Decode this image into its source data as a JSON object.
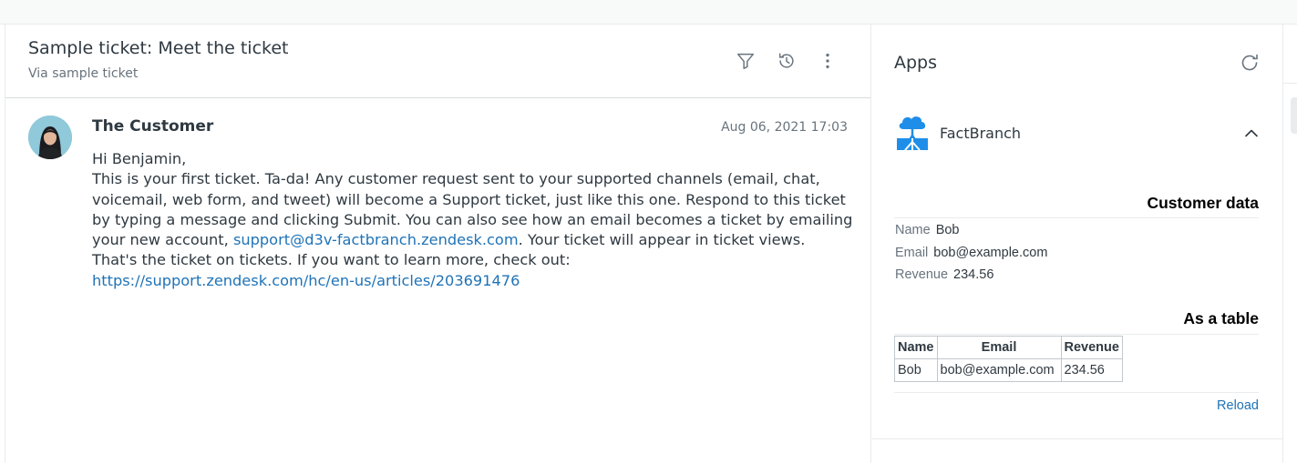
{
  "ticket": {
    "title": "Sample ticket: Meet the ticket",
    "via": "Via sample ticket",
    "icons": [
      "filter-icon",
      "history-icon",
      "more-options-icon"
    ]
  },
  "message": {
    "author": "The Customer",
    "timestamp": "Aug 06, 2021 17:03",
    "greeting": "Hi Benjamin,",
    "para1": "This is your first ticket. Ta-da! Any customer request sent to your supported channels (email, chat, voicemail, web form, and tweet) will become a Support ticket, just like this one. Respond to this ticket by typing a message and clicking Submit. You can also see how an email becomes a ticket by emailing your new account, ",
    "email_link": "support@d3v-factbranch.zendesk.com",
    "para1_end": ". Your ticket will appear in ticket views.",
    "para2": "That's the ticket on tickets. If you want to learn more, check out:",
    "url_link": "https://support.zendesk.com/hc/en-us/articles/203691476"
  },
  "apps": {
    "title": "Apps",
    "app_name": "FactBranch",
    "customer_data_title": "Customer data",
    "fields": [
      {
        "key": "Name",
        "value": "Bob"
      },
      {
        "key": "Email",
        "value": "bob@example.com"
      },
      {
        "key": "Revenue",
        "value": "234.56"
      }
    ],
    "table_title": "As a table",
    "table": {
      "headers": [
        "Name",
        "Email",
        "Revenue"
      ],
      "rows": [
        [
          "Bob",
          "bob@example.com",
          "234.56"
        ]
      ]
    },
    "reload_label": "Reload"
  },
  "colors": {
    "link": "#1f73b7",
    "text": "#2f3941",
    "muted": "#68737d",
    "app_logo": "#1f8ee8"
  }
}
